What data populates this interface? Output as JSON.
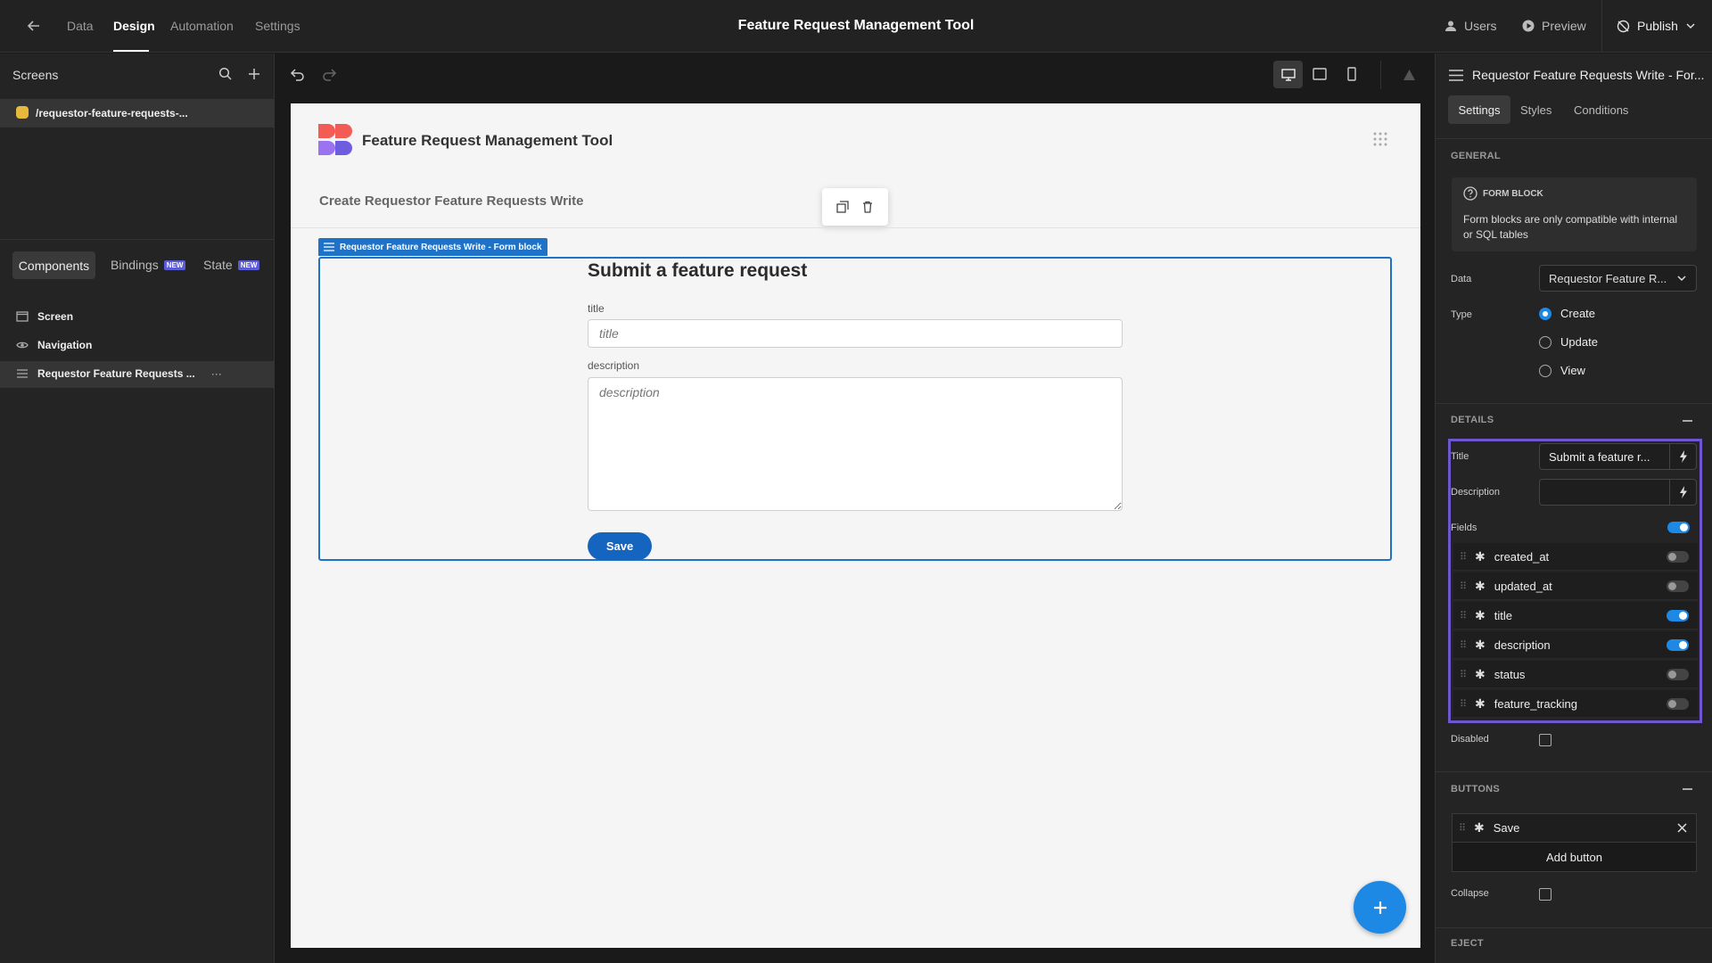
{
  "topbar": {
    "tabs": [
      "Data",
      "Design",
      "Automation",
      "Settings"
    ],
    "title": "Feature Request Management Tool",
    "users": "Users",
    "preview": "Preview",
    "publish": "Publish"
  },
  "left": {
    "screens_label": "Screens",
    "screen_path": "/requestor-feature-requests-...",
    "tabs": {
      "components": "Components",
      "bindings": "Bindings",
      "state": "State",
      "new_badge": "NEW"
    },
    "tree": [
      "Screen",
      "Navigation",
      "Requestor Feature Requests ..."
    ]
  },
  "canvas": {
    "app_title": "Feature Request Management Tool",
    "page_heading": "Create Requestor Feature Requests Write",
    "block_tag": "Requestor Feature Requests Write - Form block",
    "form": {
      "title": "Submit a feature request",
      "fields": [
        {
          "label": "title",
          "placeholder": "title"
        },
        {
          "label": "description",
          "placeholder": "description"
        }
      ],
      "save": "Save"
    }
  },
  "right": {
    "component_title": "Requestor Feature Requests Write - For...",
    "tabs": [
      "Settings",
      "Styles",
      "Conditions"
    ],
    "general": {
      "heading": "GENERAL",
      "info_title": "FORM BLOCK",
      "info_text": "Form blocks are only compatible with internal or SQL tables",
      "data_label": "Data",
      "data_value": "Requestor Feature R...",
      "type_label": "Type",
      "types": [
        "Create",
        "Update",
        "View"
      ],
      "selected_type": "Create"
    },
    "details": {
      "heading": "DETAILS",
      "title_label": "Title",
      "title_value": "Submit a feature r...",
      "description_label": "Description",
      "description_value": "",
      "fields_label": "Fields",
      "fields_enabled": true,
      "fields": [
        {
          "name": "created_at",
          "on": false
        },
        {
          "name": "updated_at",
          "on": false
        },
        {
          "name": "title",
          "on": true
        },
        {
          "name": "description",
          "on": true
        },
        {
          "name": "status",
          "on": false
        },
        {
          "name": "feature_tracking",
          "on": false
        }
      ],
      "disabled_label": "Disabled"
    },
    "buttons": {
      "heading": "BUTTONS",
      "items": [
        "Save"
      ],
      "add": "Add button",
      "collapse_label": "Collapse"
    },
    "eject_heading": "EJECT"
  },
  "colors": {
    "accent": "#1e88e5",
    "highlight": "#6e56cf",
    "form_border": "#1e72c8"
  }
}
